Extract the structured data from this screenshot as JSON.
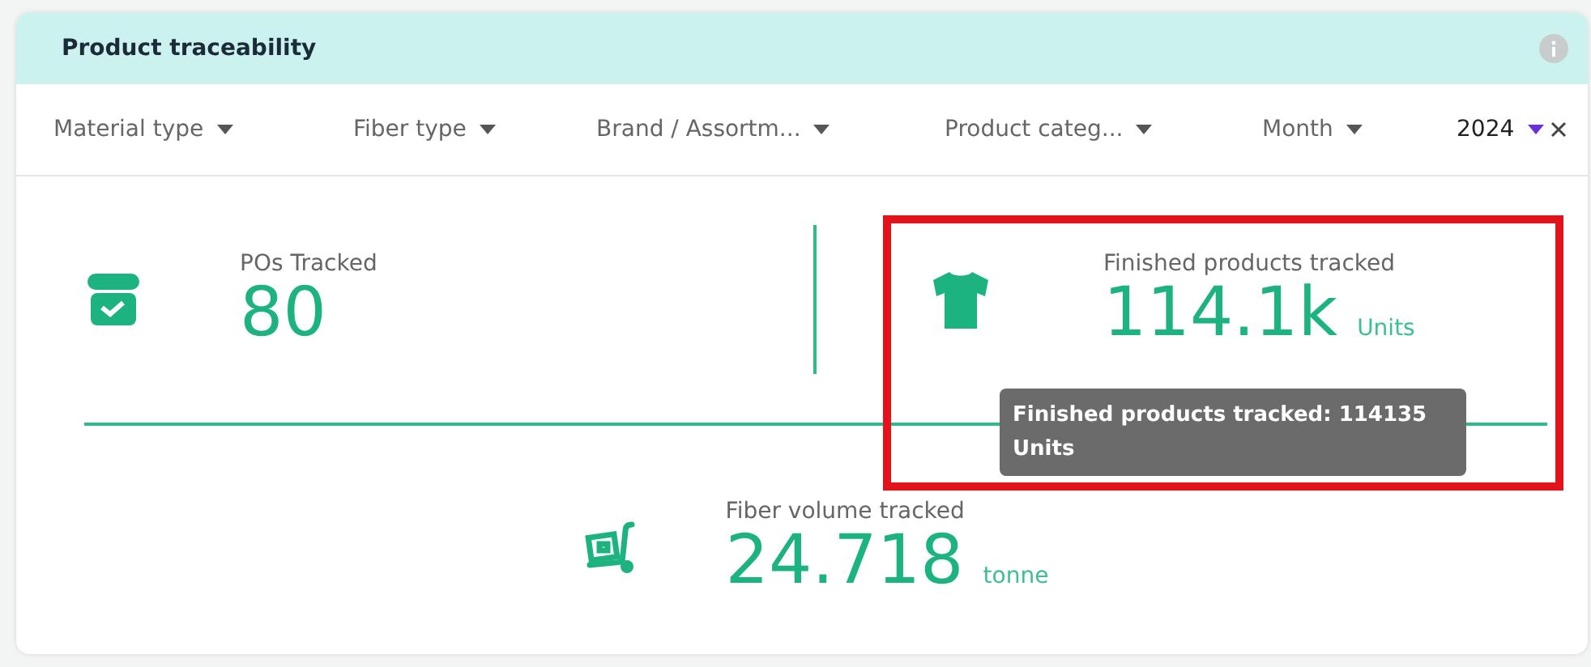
{
  "panel": {
    "title": "Product traceability"
  },
  "filters": [
    {
      "label": "Material type",
      "selected": false
    },
    {
      "label": "Fiber type",
      "selected": false
    },
    {
      "label": "Brand / Assortm...",
      "selected": false
    },
    {
      "label": "Product categ...",
      "selected": false
    },
    {
      "label": "Month",
      "selected": false
    },
    {
      "label": "2024",
      "selected": true
    }
  ],
  "stats": [
    {
      "label": "POs Tracked",
      "value": "80"
    },
    {
      "label": "Finished products tracked",
      "value": "114.1k",
      "unit": "Units"
    },
    {
      "label": "Fiber volume tracked",
      "value": "24.718",
      "unit": "tonne"
    }
  ],
  "tooltip": {
    "lines": [
      "Finished products tracked: 114135",
      "Units"
    ]
  }
}
